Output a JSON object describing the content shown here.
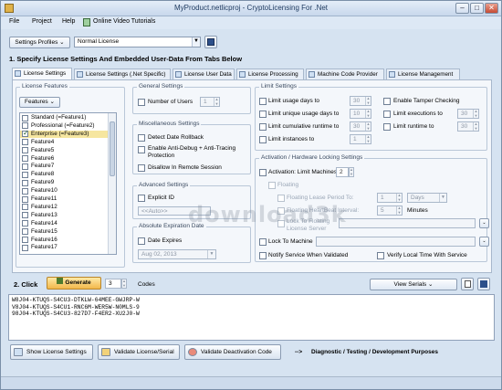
{
  "window": {
    "title": "MyProduct.netlicproj - CryptoLicensing For .Net",
    "min": "–",
    "max": "□",
    "close": "✕"
  },
  "menu": [
    "File",
    "Project",
    "Help",
    "Online Video Tutorials"
  ],
  "profile": {
    "label": "Settings Profiles",
    "value": "Normal License"
  },
  "step1": "1. Specify License Settings And Embedded User-Data From Tabs Below",
  "tabs": [
    "License Settings",
    "License Settings (.Net Specific)",
    "License User Data",
    "License Processing",
    "Machine Code Provider",
    "License Management"
  ],
  "license_features": {
    "title": "License Features",
    "button": "Features",
    "items": [
      {
        "label": "Standard (=Feature1)",
        "checked": false
      },
      {
        "label": "Professional (=Feature2)",
        "checked": false
      },
      {
        "label": "Enterprise (=Feature3)",
        "checked": true,
        "selected": true
      },
      {
        "label": "Feature4",
        "checked": false
      },
      {
        "label": "Feature5",
        "checked": false
      },
      {
        "label": "Feature6",
        "checked": false
      },
      {
        "label": "Feature7",
        "checked": false
      },
      {
        "label": "Feature8",
        "checked": false
      },
      {
        "label": "Feature9",
        "checked": false
      },
      {
        "label": "Feature10",
        "checked": false
      },
      {
        "label": "Feature11",
        "checked": false
      },
      {
        "label": "Feature12",
        "checked": false
      },
      {
        "label": "Feature13",
        "checked": false
      },
      {
        "label": "Feature14",
        "checked": false
      },
      {
        "label": "Feature15",
        "checked": false
      },
      {
        "label": "Feature16",
        "checked": false
      },
      {
        "label": "Feature17",
        "checked": false
      }
    ]
  },
  "general": {
    "title": "General Settings",
    "num_users": "Number of Users",
    "num_users_val": "1"
  },
  "misc": {
    "title": "Miscellaneous Settings",
    "detect": "Detect Date Rollback",
    "antidebug1": "Enable Anti-Debug + Anti-Tracing",
    "antidebug2": "Protection",
    "disallow": "Disallow In Remote Session"
  },
  "advanced": {
    "title": "Advanced Settings",
    "explicit": "Explicit ID",
    "auto": "<<Auto>>"
  },
  "expiration": {
    "title": "Absolute Expiration Date",
    "expires": "Date Expires",
    "date": "Aug 02, 2013"
  },
  "limits": {
    "title": "Limit Settings",
    "usage_days": "Limit usage days to",
    "usage_days_val": "30",
    "unique_days": "Limit unique usage days to",
    "unique_days_val": "10",
    "cumulative": "Limit cumulative runtime to",
    "cumulative_val": "30",
    "instances": "Limit instances to",
    "instances_val": "1",
    "tamper": "Enable Tamper Checking",
    "executions": "Limit executions to",
    "executions_val": "30",
    "runtime": "Limit runtime to",
    "runtime_val": "30"
  },
  "activation": {
    "title": "Activation / Hardware Locking Settings",
    "limit": "Activation: Limit Machines To",
    "limit_val": "2",
    "floating": "Floating",
    "lease": "Floating Lease Period To:",
    "lease_val": "1",
    "lease_unit": "Days",
    "heartbeat": "Floating HeartBeat Interval:",
    "heartbeat_val": "5",
    "heartbeat_unit": "Minutes",
    "lock_floating1": "Lock To Floating",
    "lock_floating2": "License Server",
    "lock_machine": "Lock To Machine",
    "notify": "Notify Service When Validated",
    "verify": "Verify Local Time With Service"
  },
  "step2": {
    "label": "2. Click",
    "generate": "Generate",
    "count": "3",
    "codes": "Codes",
    "view": "View Serials"
  },
  "serials": [
    "W8J04-KTUQS-S4CU3-DTKLW-64MEE-GWJRP-W",
    "V8J04-KTUQS-S4CU1-RNC6M-WER5W-N0MLS-9",
    "98J04-KTUQS-S4CU3-827D7-F4ER2-XU2J0-W"
  ],
  "bottom": {
    "show": "Show License Settings",
    "validate": "Validate License/Serial",
    "deactivate": "Validate Deactivation Code",
    "arrow": "-->",
    "diag": "Diagnostic / Testing / Development Purposes"
  },
  "watermark": "download3k"
}
